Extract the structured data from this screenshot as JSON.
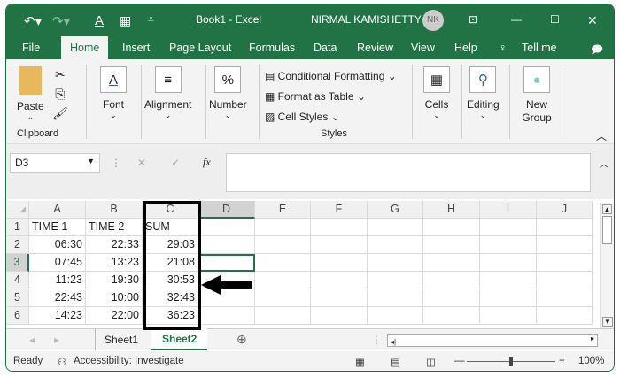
{
  "title": {
    "document": "Book1  -  Excel",
    "user": "NIRMAL KAMISHETTY",
    "initials": "NK"
  },
  "tabs": [
    "File",
    "Home",
    "Insert",
    "Page Layout",
    "Formulas",
    "Data",
    "Review",
    "View",
    "Help",
    "Tell me"
  ],
  "ribbon": {
    "paste": "Paste",
    "clipboard": "Clipboard",
    "font": "Font",
    "alignment": "Alignment",
    "number": "Number",
    "number_icon": "%",
    "conditional": "Conditional Formatting",
    "format_table": "Format as Table",
    "cell_styles": "Cell Styles",
    "styles": "Styles",
    "cells": "Cells",
    "editing": "Editing",
    "new_group": "New Group"
  },
  "formula": {
    "name_box": "D3",
    "fx": "fx",
    "value": ""
  },
  "columns": [
    "A",
    "B",
    "C",
    "D",
    "E",
    "F",
    "G",
    "H",
    "I",
    "J"
  ],
  "rows": [
    {
      "n": "1",
      "cells": [
        "TIME 1",
        "TIME 2",
        "SUM"
      ]
    },
    {
      "n": "2",
      "cells": [
        "06:30",
        "22:33",
        "29:03"
      ]
    },
    {
      "n": "3",
      "cells": [
        "07:45",
        "13:23",
        "21:08"
      ]
    },
    {
      "n": "4",
      "cells": [
        "11:23",
        "19:30",
        "30:53"
      ]
    },
    {
      "n": "5",
      "cells": [
        "22:43",
        "10:00",
        "32:43"
      ]
    },
    {
      "n": "6",
      "cells": [
        "14:23",
        "22:00",
        "36:23"
      ]
    }
  ],
  "sheets": [
    "Sheet1",
    "Sheet2"
  ],
  "status": {
    "ready": "Ready",
    "accessibility": "Accessibility: Investigate",
    "zoom": "100%"
  },
  "colors": {
    "accent": "#217346"
  }
}
